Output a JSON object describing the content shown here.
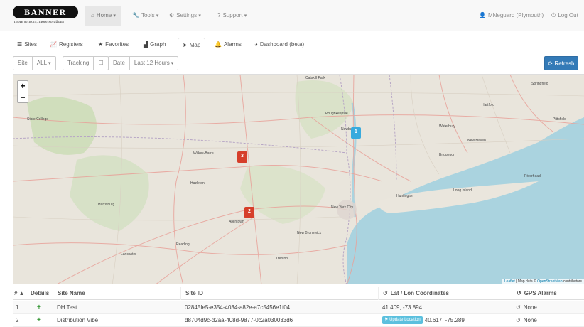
{
  "brand": {
    "logo_text": "BANNER",
    "tagline": "more sensors, more solutions"
  },
  "navbar": {
    "home": "Home",
    "tools": "Tools",
    "settings": "Settings",
    "support": "Support",
    "user": "MNeguard (Plymouth)",
    "logout": "Log Out"
  },
  "tabs": [
    {
      "label": "Sites",
      "icon": "list-icon"
    },
    {
      "label": "Registers",
      "icon": "line-chart-icon"
    },
    {
      "label": "Favorites",
      "icon": "star-icon"
    },
    {
      "label": "Graph",
      "icon": "area-chart-icon"
    },
    {
      "label": "Map",
      "icon": "location-arrow-icon"
    },
    {
      "label": "Alarms",
      "icon": "bell-icon"
    },
    {
      "label": "Dashboard (beta)",
      "icon": "dashboard-icon"
    }
  ],
  "filters": {
    "site_label": "Site",
    "site_value": "ALL",
    "tracking_label": "Tracking",
    "date_label": "Date",
    "date_value": "Last 12 Hours",
    "refresh": "Refresh"
  },
  "map": {
    "zoom_in": "+",
    "zoom_out": "−",
    "attribution_leaflet": "Leaflet",
    "attribution_text": "Map data ©",
    "attribution_osm": "OpenStreetMap",
    "attribution_tail": "contributors",
    "markers": [
      {
        "label": "3",
        "color": "#d63e2a"
      },
      {
        "label": "2",
        "color": "#d63e2a"
      },
      {
        "label": "1",
        "color": "#38aadd"
      }
    ],
    "places": {
      "catskill": "Catskill Park",
      "poughkeepsie": "Poughkeepsie",
      "newburgh": "Newburgh",
      "wilkes_barre": "Wilkes-Barre",
      "hazleton": "Hazleton",
      "allentown": "Allentown",
      "new_york": "New York City",
      "new_brunswick": "New Brunswick",
      "harrisburg": "Harrisburg",
      "lancaster": "Lancaster",
      "trenton": "Trenton",
      "long_island": "Long Island",
      "riverhead": "Riverhead",
      "bridgeport": "Bridgeport",
      "hartford": "Hartford",
      "huntington": "Huntington",
      "springfield": "Springfield",
      "state_college": "State College",
      "reading": "Reading",
      "waterbury": "Waterbury",
      "new_haven": "New Haven",
      "pittsfield": "Pittsfield"
    }
  },
  "table": {
    "headers": {
      "num": "# ▲",
      "details": "Details",
      "site_name": "Site Name",
      "site_id": "Site ID",
      "latlon": "Lat / Lon Coordinates",
      "gps": "GPS Alarms"
    },
    "rows": [
      {
        "num": "1",
        "site_name": "DH Test",
        "site_id": "02845fe5-e354-4034-a82e-a7c5456e1f04",
        "update": "",
        "latlon": "41.409, -73.894",
        "gps": "None"
      },
      {
        "num": "2",
        "site_name": "Distribution Vibe",
        "site_id": "d8704d9c-d2aa-408d-9877-0c2a030033d6",
        "update": "Update Location",
        "latlon": "40.617, -75.289",
        "gps": "None"
      }
    ]
  }
}
